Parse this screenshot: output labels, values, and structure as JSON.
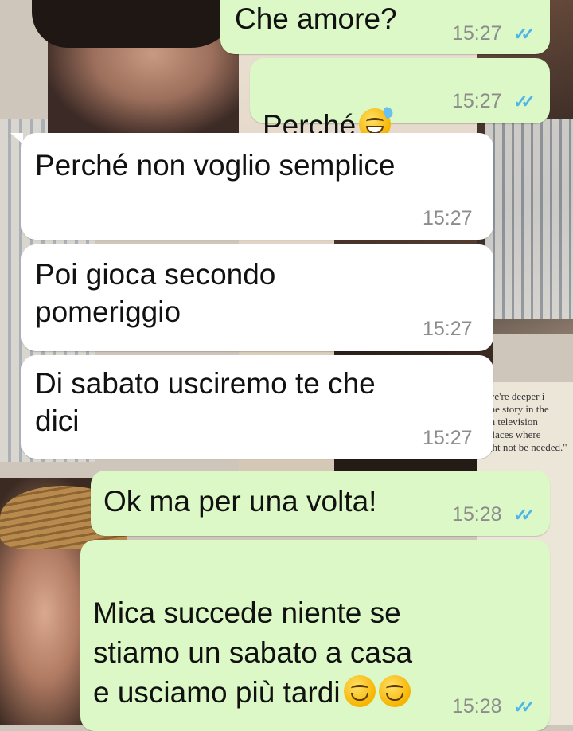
{
  "messages": [
    {
      "dir": "out",
      "text": "Che amore?",
      "time": "15:27",
      "ticks": "✓✓"
    },
    {
      "dir": "out",
      "text": "Perché",
      "emoji": "sweat-smile",
      "time": "15:27",
      "ticks": "✓✓"
    },
    {
      "dir": "in",
      "text": "Perché non voglio semplice",
      "time": "15:27"
    },
    {
      "dir": "in",
      "text": "Poi gioca secondo\npomeriggio",
      "time": "15:27"
    },
    {
      "dir": "in",
      "text": "Di sabato usciremo te che\ndici",
      "time": "15:27"
    },
    {
      "dir": "out",
      "text": "Ok ma per una volta!",
      "time": "15:28",
      "ticks": "✓✓"
    },
    {
      "dir": "out",
      "text": "Mica succede niente se\nstiamo un sabato a casa\ne usciamo più tardi",
      "emoji": "smiling-face x2",
      "time": "15:28",
      "ticks": "✓✓"
    }
  ],
  "wallpaper_text": "we're deeper i\nthe story in the\nin television\nplaces where\nght not be needed.\""
}
